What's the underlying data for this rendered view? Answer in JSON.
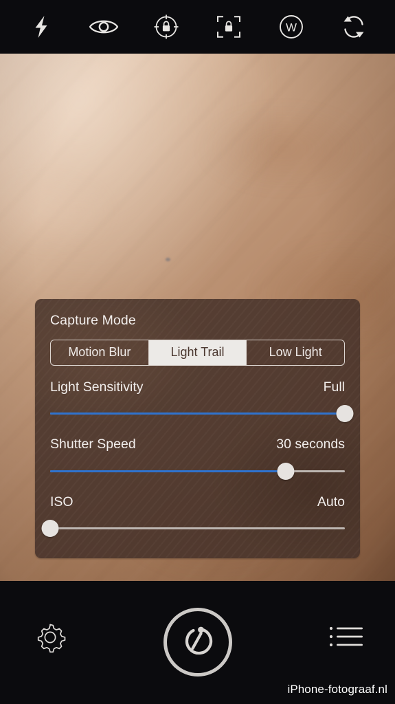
{
  "topbar": {
    "items": [
      {
        "name": "flash-icon",
        "label": "Flash"
      },
      {
        "name": "eye-icon",
        "label": "Live Preview"
      },
      {
        "name": "focus-lock-icon",
        "label": "Focus Lock"
      },
      {
        "name": "exposure-lock-icon",
        "label": "Exposure Lock"
      },
      {
        "name": "white-balance-icon",
        "label": "W"
      },
      {
        "name": "switch-camera-icon",
        "label": "Switch Camera"
      }
    ],
    "white_balance_letter": "W"
  },
  "panel": {
    "capture_mode": {
      "label": "Capture Mode",
      "options": [
        {
          "label": "Motion Blur",
          "selected": false
        },
        {
          "label": "Light Trail",
          "selected": true
        },
        {
          "label": "Low Light",
          "selected": false
        }
      ],
      "selected": "Light Trail"
    },
    "sliders": [
      {
        "label": "Light Sensitivity",
        "value": "Full",
        "percent": 100,
        "filled": true
      },
      {
        "label": "Shutter Speed",
        "value": "30 seconds",
        "percent": 80,
        "filled": true
      },
      {
        "label": "ISO",
        "value": "Auto",
        "percent": 0,
        "filled": false
      }
    ]
  },
  "bottombar": {
    "settings_label": "Settings",
    "shutter_label": "Shutter",
    "shutter_mode": "timer",
    "library_label": "Library"
  },
  "watermark": "iPhone-fotograaf.nl",
  "colors": {
    "accent_blue": "#2f73cf",
    "panel_background": "#49342b",
    "bar_background": "#0b0b0e",
    "icon_stroke": "#e8e6e3",
    "selected_segment_bg": "#eceae7"
  }
}
